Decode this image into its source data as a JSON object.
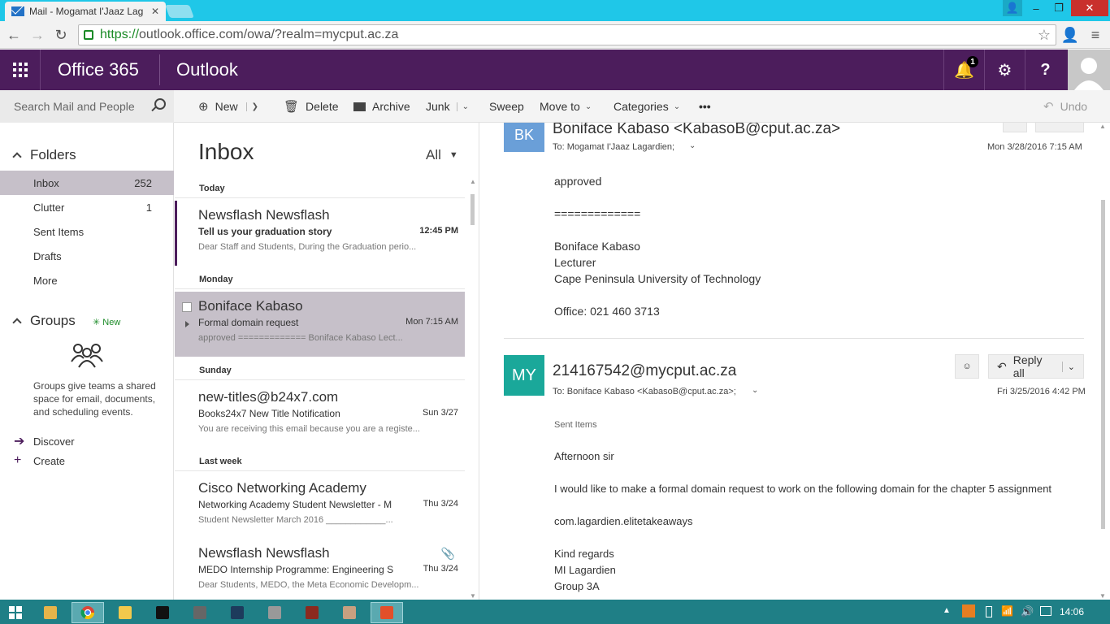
{
  "browser": {
    "tab_title": "Mail - Mogamat I'Jaaz Lag",
    "url_scheme": "https://",
    "url_rest": "outlook.office.com/owa/?realm=mycput.ac.za"
  },
  "suite": {
    "brand": "Office 365",
    "app": "Outlook",
    "notification_count": "1"
  },
  "commands": {
    "search_placeholder": "Search Mail and People",
    "new": "New",
    "delete": "Delete",
    "archive": "Archive",
    "junk": "Junk",
    "sweep": "Sweep",
    "move_to": "Move to",
    "categories": "Categories",
    "more": "•••",
    "undo": "Undo"
  },
  "nav": {
    "folders_title": "Folders",
    "folders": [
      {
        "label": "Inbox",
        "count": "252"
      },
      {
        "label": "Clutter",
        "count": "1"
      },
      {
        "label": "Sent Items",
        "count": ""
      },
      {
        "label": "Drafts",
        "count": ""
      },
      {
        "label": "More",
        "count": ""
      }
    ],
    "groups_title": "Groups",
    "groups_new": "New",
    "groups_desc": "Groups give teams a shared space for email, documents, and scheduling events.",
    "discover": "Discover",
    "create": "Create"
  },
  "list": {
    "title": "Inbox",
    "filter": "All",
    "days": [
      "Today",
      "Monday",
      "Sunday",
      "Last week"
    ],
    "messages": [
      {
        "from": "Newsflash Newsflash",
        "subject": "Tell us your graduation story",
        "time": "12:45 PM",
        "preview": "Dear Staff and Students, During the Graduation perio..."
      },
      {
        "from": "Boniface Kabaso",
        "subject": "Formal domain request",
        "time": "Mon 7:15 AM",
        "preview": "approved   =============   Boniface Kabaso Lect..."
      },
      {
        "from": "new-titles@b24x7.com",
        "subject": "Books24x7 New Title Notification",
        "time": "Sun 3/27",
        "preview": "You are receiving this email because you are a registe..."
      },
      {
        "from": "Cisco Networking Academy",
        "subject": "Networking Academy Student Newsletter - M",
        "time": "Thu 3/24",
        "preview": "Student Newsletter          March 2016          ____________..."
      },
      {
        "from": "Newsflash Newsflash",
        "subject": "MEDO Internship Programme: Engineering St",
        "time": "Thu 3/24",
        "preview": "Dear Students, MEDO, the Meta Economic Developm..."
      }
    ]
  },
  "reading": {
    "msg1": {
      "initials": "BK",
      "sender": "Boniface Kabaso <KabasoB@cput.ac.za>",
      "to": "To:  Mogamat I'Jaaz Lagardien;",
      "date": "Mon 3/28/2016 7:15 AM",
      "body": "approved\n\n=============\n\nBoniface Kabaso\nLecturer\nCape Peninsula University of Technology\n\nOffice: 021 460 3713"
    },
    "msg2": {
      "initials": "MY",
      "sender": "214167542@mycput.ac.za",
      "to": "To:  Boniface Kabaso <KabasoB@cput.ac.za>;",
      "date": "Fri 3/25/2016 4:42 PM",
      "folder": "Sent Items",
      "reply_all": "Reply all",
      "body": "Afternoon sir\n\nI would like to make a formal domain request to work on the following domain for the chapter 5 assignment\n\ncom.lagardien.elitetakeaways\n\nKind regards\nMI Lagardien\nGroup 3A"
    }
  },
  "taskbar": {
    "clock": "14:06"
  },
  "colors": {
    "suite_purple": "#4c1d5c",
    "selection": "#c6c0c9",
    "avatar_bk": "#6a9fd8",
    "avatar_my": "#1aa89a",
    "chrome_tabstrip": "#1fc7e8",
    "taskbar": "#1f7f86"
  }
}
